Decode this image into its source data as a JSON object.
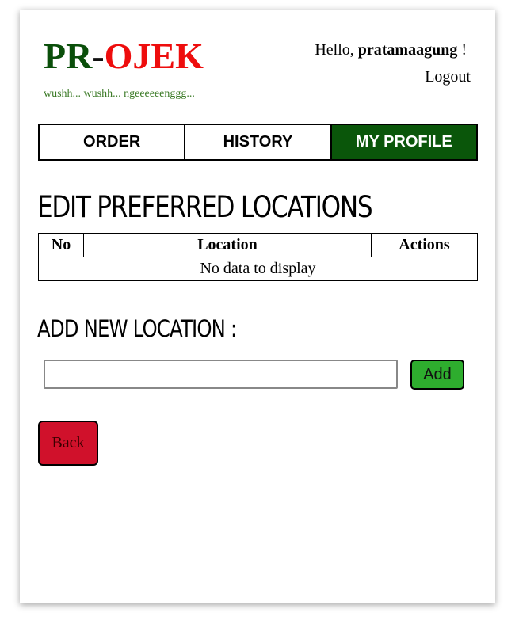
{
  "logo": {
    "part1": "PR",
    "separator": "-",
    "part2": "OJEK",
    "colors": {
      "part1": "#0a4f0a",
      "part2": "#ee0d0d"
    }
  },
  "tagline": "wushh... wushh... ngeeeeeenggg...",
  "user": {
    "greeting": "Hello,",
    "username": "pratamaagung",
    "suffix": " !",
    "logout_label": "Logout"
  },
  "nav": {
    "tabs": [
      {
        "label": "ORDER"
      },
      {
        "label": "HISTORY"
      },
      {
        "label": "MY PROFILE",
        "active": true
      }
    ],
    "active_color": "#0a560a"
  },
  "edit_section": {
    "title": "EDIT PREFERRED LOCATIONS"
  },
  "table": {
    "columns": [
      "No",
      "Location",
      "Actions"
    ],
    "empty_message": "No data to display"
  },
  "add_section": {
    "title": "ADD NEW LOCATION :",
    "input_value": "",
    "add_label": "Add",
    "add_color": "#2ead2e"
  },
  "back_label": "Back",
  "back_color": "#d0112b"
}
